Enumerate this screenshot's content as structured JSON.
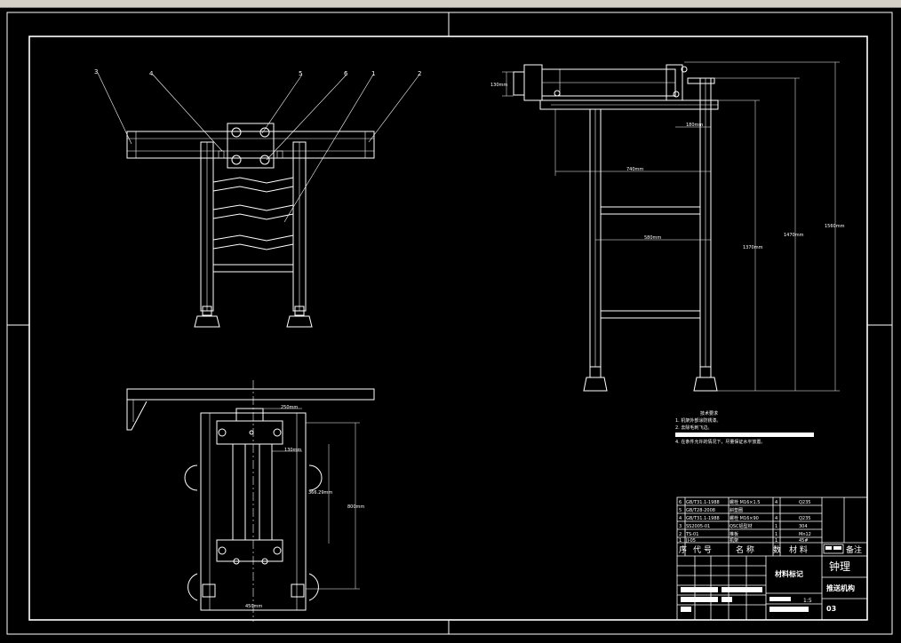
{
  "toolbar": {
    "icons": [
      "open-icon",
      "save-icon",
      "zoom-icon",
      "pan-icon",
      "text-icon",
      "layer-icon",
      "grid-icon",
      "properties-icon",
      "help-icon"
    ]
  },
  "balloons_front": [
    "3",
    "4",
    "5",
    "6",
    "1",
    "2"
  ],
  "dimensions": {
    "d130": "130mm",
    "d180": "180mm",
    "d740": "740mm",
    "d580": "580mm",
    "d1370": "1370mm",
    "d1470": "1470mm",
    "d1560": "1560mm",
    "d250": "250mm",
    "d130b": "130mm",
    "d366": "366.29mm",
    "d800": "800mm",
    "d450": "450mm"
  },
  "tech_notes": {
    "title": "技术要求",
    "items": [
      "1. 机架外部涂防锈漆。",
      "2. 去除毛刺飞边。",
      "4. 在条件允许的情况下，尽量保证水平放置。"
    ]
  },
  "bom": {
    "rows": [
      {
        "no": "6",
        "code": "GB/T31.1-1988",
        "name": "螺栓 M16×1.5",
        "qty": "4",
        "material": "Q235"
      },
      {
        "no": "5",
        "code": "GB/T28-2008",
        "name": "斜垫圈",
        "qty": "",
        "material": ""
      },
      {
        "no": "4",
        "code": "GB/T31.1-1988",
        "name": "螺栓 M16×90",
        "qty": "4",
        "material": "Q235"
      },
      {
        "no": "3",
        "code": "SS2005-01",
        "name": "QSC铝型材",
        "qty": "1",
        "material": "304"
      },
      {
        "no": "2",
        "code": "TS-01",
        "name": "推板",
        "qty": "1",
        "material": "Mn12"
      },
      {
        "no": "1",
        "code": "JJ-05",
        "name": "机架",
        "qty": "1",
        "material": "45#"
      }
    ],
    "header": {
      "no": "序",
      "code": "代 号",
      "name": "名 称",
      "qty": "数",
      "material": "材 料",
      "remark": "备注"
    }
  },
  "title_block": {
    "company": "钟理",
    "mark": "材料标记",
    "drawing_name": "推送机构",
    "scale": "1:5",
    "number": "03"
  }
}
